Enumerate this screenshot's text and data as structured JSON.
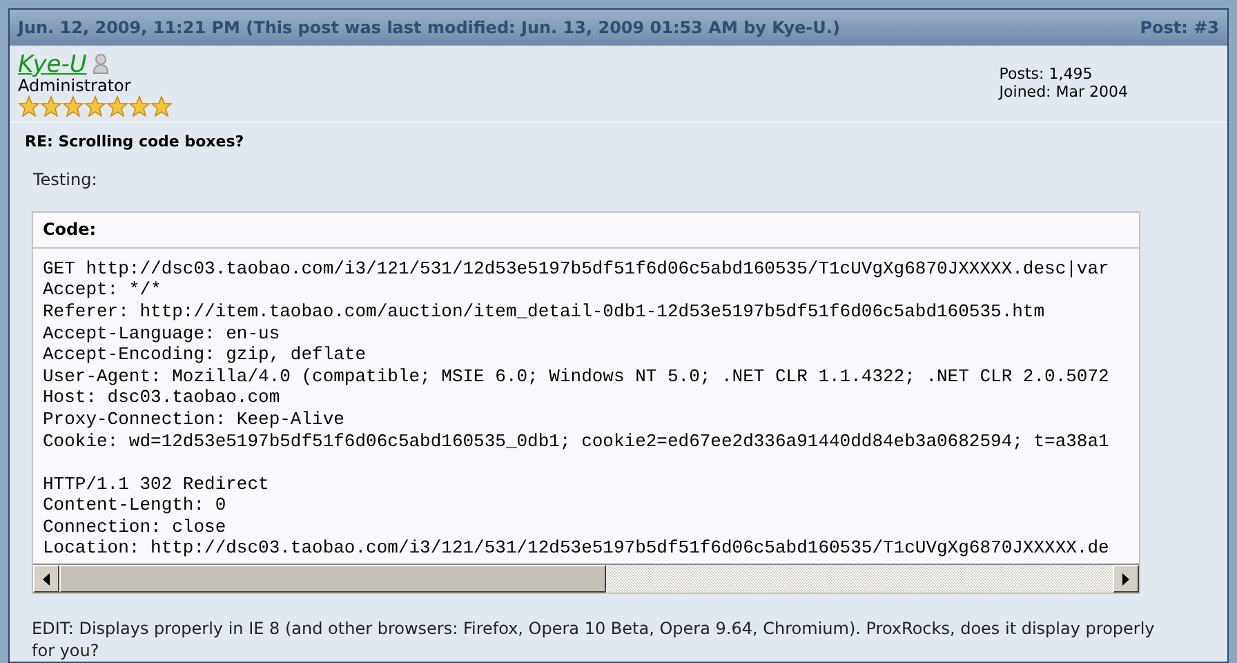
{
  "post": {
    "header": "Jun. 12, 2009, 11:21 PM (This post was last modified: Jun. 13, 2009 01:53 AM by Kye-U.)",
    "post_number": "Post: #3"
  },
  "author": {
    "name": "Kye-U",
    "online": false,
    "rank": "Administrator",
    "stars": 7,
    "posts": "Posts: 1,495",
    "joined": "Joined: Mar 2004"
  },
  "subject": "RE: Scrolling code boxes?",
  "intro": "Testing:",
  "code_box": {
    "label": "Code:",
    "request_lines": [
      "GET http://dsc03.taobao.com/i3/121/531/12d53e5197b5df51f6d06c5abd160535/T1cUVgXg6870JXXXXX.desc|var",
      "Accept: */*",
      "Referer: http://item.taobao.com/auction/item_detail-0db1-12d53e5197b5df51f6d06c5abd160535.htm",
      "Accept-Language: en-us",
      "Accept-Encoding: gzip, deflate",
      "User-Agent: Mozilla/4.0 (compatible; MSIE 6.0; Windows NT 5.0; .NET CLR 1.1.4322; .NET CLR 2.0.5072",
      "Host: dsc03.taobao.com",
      "Proxy-Connection: Keep-Alive",
      "Cookie: wd=12d53e5197b5df51f6d06c5abd160535_0db1; cookie2=ed67ee2d336a91440dd84eb3a0682594; t=a38a1"
    ],
    "response_lines": [
      "HTTP/1.1 302 Redirect",
      "Content-Length: 0",
      "Connection: close",
      "Location: http://dsc03.taobao.com/i3/121/531/12d53e5197b5df51f6d06c5abd160535/T1cUVgXg6870JXXXXX.de"
    ]
  },
  "edit_note": "EDIT: Displays properly in IE 8 (and other browsers: Firefox, Opera 10 Beta, Opera 9.64, Chromium). ProxRocks, does it display properly for you?"
}
